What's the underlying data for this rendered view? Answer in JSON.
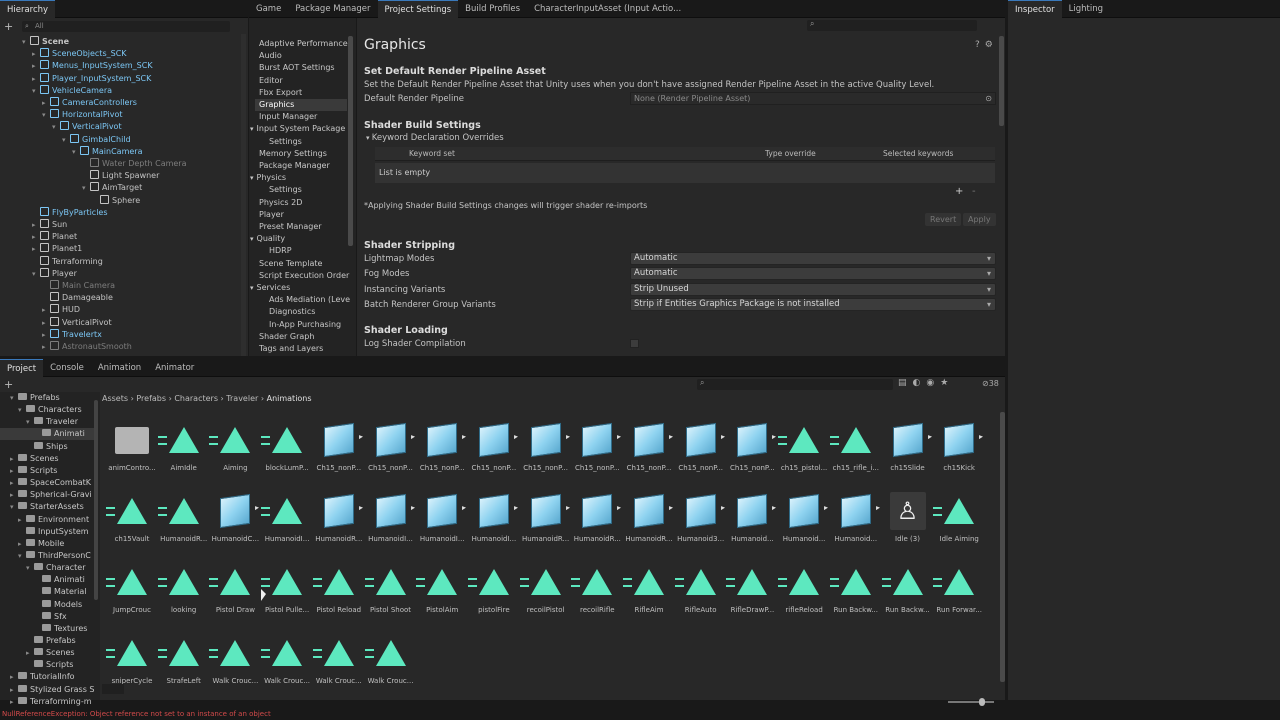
{
  "hierarchy": {
    "tab": "Hierarchy",
    "search_placeholder": "All",
    "items": [
      {
        "label": "Scene",
        "indent": 0,
        "color": "white",
        "arrow": "▾"
      },
      {
        "label": "SceneObjects_SCK",
        "indent": 1,
        "color": "blue",
        "arrow": "▸"
      },
      {
        "label": "Menus_InputSystem_SCK",
        "indent": 1,
        "color": "blue",
        "arrow": "▸"
      },
      {
        "label": "Player_InputSystem_SCK",
        "indent": 1,
        "color": "blue",
        "arrow": "▸"
      },
      {
        "label": "VehicleCamera",
        "indent": 1,
        "color": "blue",
        "arrow": "▾"
      },
      {
        "label": "CameraControllers",
        "indent": 2,
        "color": "blue",
        "arrow": "▸"
      },
      {
        "label": "HorizontalPivot",
        "indent": 2,
        "color": "blue",
        "arrow": "▾"
      },
      {
        "label": "VerticalPivot",
        "indent": 3,
        "color": "blue",
        "arrow": "▾"
      },
      {
        "label": "GimbalChild",
        "indent": 4,
        "color": "blue",
        "arrow": "▾"
      },
      {
        "label": "MainCamera",
        "indent": 5,
        "color": "blue",
        "arrow": "▾"
      },
      {
        "label": "Water Depth Camera",
        "indent": 6,
        "color": "gray",
        "arrow": ""
      },
      {
        "label": "Light Spawner",
        "indent": 6,
        "color": "white",
        "arrow": ""
      },
      {
        "label": "AimTarget",
        "indent": 6,
        "color": "white",
        "arrow": "▾"
      },
      {
        "label": "Sphere",
        "indent": 7,
        "color": "white",
        "arrow": ""
      },
      {
        "label": "FlyByParticles",
        "indent": 1,
        "color": "blue",
        "arrow": ""
      },
      {
        "label": "Sun",
        "indent": 1,
        "color": "white",
        "arrow": "▸"
      },
      {
        "label": "Planet",
        "indent": 1,
        "color": "white",
        "arrow": "▸"
      },
      {
        "label": "Planet1",
        "indent": 1,
        "color": "white",
        "arrow": "▸"
      },
      {
        "label": "Terraforming",
        "indent": 1,
        "color": "white",
        "arrow": ""
      },
      {
        "label": "Player",
        "indent": 1,
        "color": "white",
        "arrow": "▾"
      },
      {
        "label": "Main Camera",
        "indent": 2,
        "color": "gray",
        "arrow": ""
      },
      {
        "label": "Damageable",
        "indent": 2,
        "color": "white",
        "arrow": ""
      },
      {
        "label": "HUD",
        "indent": 2,
        "color": "white",
        "arrow": "▸"
      },
      {
        "label": "VerticalPivot",
        "indent": 2,
        "color": "white",
        "arrow": "▸"
      },
      {
        "label": "Travelertx",
        "indent": 2,
        "color": "blue",
        "arrow": "▸"
      },
      {
        "label": "AstronautSmooth",
        "indent": 2,
        "color": "gray",
        "arrow": "▸"
      }
    ]
  },
  "top_tabs": [
    "Game",
    "Package Manager",
    "Project Settings",
    "Build Profiles",
    "CharacterInputAsset (Input Actio..."
  ],
  "right_tabs": [
    "Inspector",
    "Lighting"
  ],
  "settings_nav": [
    {
      "label": "Adaptive Performance",
      "indent": 0
    },
    {
      "label": "Audio",
      "indent": 0
    },
    {
      "label": "Burst AOT Settings",
      "indent": 0
    },
    {
      "label": "Editor",
      "indent": 0
    },
    {
      "label": "Fbx Export",
      "indent": 0
    },
    {
      "label": "Graphics",
      "indent": 0,
      "active": true
    },
    {
      "label": "Input Manager",
      "indent": 0
    },
    {
      "label": "Input System Package",
      "indent": 0,
      "arrow": "▾"
    },
    {
      "label": "Settings",
      "indent": 1
    },
    {
      "label": "Memory Settings",
      "indent": 0
    },
    {
      "label": "Package Manager",
      "indent": 0
    },
    {
      "label": "Physics",
      "indent": 0,
      "arrow": "▾"
    },
    {
      "label": "Settings",
      "indent": 1
    },
    {
      "label": "Physics 2D",
      "indent": 0
    },
    {
      "label": "Player",
      "indent": 0
    },
    {
      "label": "Preset Manager",
      "indent": 0
    },
    {
      "label": "Quality",
      "indent": 0,
      "arrow": "▾"
    },
    {
      "label": "HDRP",
      "indent": 1
    },
    {
      "label": "Scene Template",
      "indent": 0
    },
    {
      "label": "Script Execution Order",
      "indent": 0
    },
    {
      "label": "Services",
      "indent": 0,
      "arrow": "▾"
    },
    {
      "label": "Ads Mediation (Leve",
      "indent": 1
    },
    {
      "label": "Diagnostics",
      "indent": 1
    },
    {
      "label": "In-App Purchasing",
      "indent": 1
    },
    {
      "label": "Shader Graph",
      "indent": 0
    },
    {
      "label": "Tags and Layers",
      "indent": 0
    }
  ],
  "graphics": {
    "title": "Graphics",
    "rp_heading": "Set Default Render Pipeline Asset",
    "rp_desc": "Set the Default Render Pipeline Asset that Unity uses when you don't have assigned Render Pipeline Asset in the active Quality Level.",
    "rp_label": "Default Render Pipeline",
    "rp_value": "None (Render Pipeline Asset)",
    "build_heading": "Shader Build Settings",
    "keyword_foldout": "Keyword Declaration Overrides",
    "col_keyword": "Keyword set",
    "col_type": "Type override",
    "col_selected": "Selected keywords",
    "list_empty": "List is empty",
    "apply_note": "*Applying Shader Build Settings changes will trigger shader re-imports",
    "revert": "Revert",
    "apply": "Apply",
    "stripping_heading": "Shader Stripping",
    "strip_rows": [
      {
        "label": "Lightmap Modes",
        "value": "Automatic"
      },
      {
        "label": "Fog Modes",
        "value": "Automatic"
      },
      {
        "label": "Instancing Variants",
        "value": "Strip Unused"
      },
      {
        "label": "Batch Renderer Group Variants",
        "value": "Strip if Entities Graphics Package is not installed"
      }
    ],
    "loading_heading": "Shader Loading",
    "log_label": "Log Shader Compilation"
  },
  "bottom_tabs": [
    "Project",
    "Console",
    "Animation",
    "Animator"
  ],
  "project_tree": [
    {
      "label": "Prefabs",
      "indent": 1,
      "arrow": "▾"
    },
    {
      "label": "Characters",
      "indent": 2,
      "arrow": "▾"
    },
    {
      "label": "Traveler",
      "indent": 3,
      "arrow": "▾"
    },
    {
      "label": "Animati",
      "indent": 4,
      "arrow": "",
      "selected": true
    },
    {
      "label": "Ships",
      "indent": 3,
      "arrow": ""
    },
    {
      "label": "Scenes",
      "indent": 1,
      "arrow": "▸"
    },
    {
      "label": "Scripts",
      "indent": 1,
      "arrow": "▸"
    },
    {
      "label": "SpaceCombatK",
      "indent": 1,
      "arrow": "▸"
    },
    {
      "label": "Spherical-Gravi",
      "indent": 1,
      "arrow": "▸"
    },
    {
      "label": "StarterAssets",
      "indent": 1,
      "arrow": "▾"
    },
    {
      "label": "Environment",
      "indent": 2,
      "arrow": "▸"
    },
    {
      "label": "InputSystem",
      "indent": 2,
      "arrow": ""
    },
    {
      "label": "Mobile",
      "indent": 2,
      "arrow": "▸"
    },
    {
      "label": "ThirdPersonC",
      "indent": 2,
      "arrow": "▾"
    },
    {
      "label": "Character",
      "indent": 3,
      "arrow": "▾"
    },
    {
      "label": "Animati",
      "indent": 4,
      "arrow": ""
    },
    {
      "label": "Material",
      "indent": 4,
      "arrow": ""
    },
    {
      "label": "Models",
      "indent": 4,
      "arrow": ""
    },
    {
      "label": "Sfx",
      "indent": 4,
      "arrow": ""
    },
    {
      "label": "Textures",
      "indent": 4,
      "arrow": ""
    },
    {
      "label": "Prefabs",
      "indent": 3,
      "arrow": ""
    },
    {
      "label": "Scenes",
      "indent": 3,
      "arrow": "▸"
    },
    {
      "label": "Scripts",
      "indent": 3,
      "arrow": ""
    },
    {
      "label": "TutorialInfo",
      "indent": 1,
      "arrow": "▸"
    },
    {
      "label": "Stylized Grass S",
      "indent": 1,
      "arrow": "▸"
    },
    {
      "label": "Terraforming-m",
      "indent": 1,
      "arrow": "▸"
    }
  ],
  "breadcrumb": [
    "Assets",
    "Prefabs",
    "Characters",
    "Traveler",
    "Animations"
  ],
  "item_count": "38",
  "assets": [
    {
      "name": "animContro...",
      "type": "folder"
    },
    {
      "name": "AimIdle",
      "type": "clip"
    },
    {
      "name": "Aiming",
      "type": "clip"
    },
    {
      "name": "blockLumP...",
      "type": "clip"
    },
    {
      "name": "Ch15_nonP...",
      "type": "model"
    },
    {
      "name": "Ch15_nonP...",
      "type": "model"
    },
    {
      "name": "Ch15_nonP...",
      "type": "model"
    },
    {
      "name": "Ch15_nonP...",
      "type": "model"
    },
    {
      "name": "Ch15_nonP...",
      "type": "model"
    },
    {
      "name": "Ch15_nonP...",
      "type": "model"
    },
    {
      "name": "Ch15_nonP...",
      "type": "model"
    },
    {
      "name": "Ch15_nonP...",
      "type": "model"
    },
    {
      "name": "Ch15_nonP...",
      "type": "model"
    },
    {
      "name": "ch15_pistol...",
      "type": "clip"
    },
    {
      "name": "ch15_rifle_i...",
      "type": "clip"
    },
    {
      "name": "ch15Slide",
      "type": "model"
    },
    {
      "name": "ch15Kick",
      "type": "model"
    },
    {
      "name": "ch15Vault",
      "type": "clip"
    },
    {
      "name": "HumanoidR...",
      "type": "clip"
    },
    {
      "name": "HumanoidC...",
      "type": "model"
    },
    {
      "name": "HumanoidI...",
      "type": "clip"
    },
    {
      "name": "HumanoidR...",
      "type": "model"
    },
    {
      "name": "HumanoidI...",
      "type": "model"
    },
    {
      "name": "HumanoidI...",
      "type": "model"
    },
    {
      "name": "HumanoidI...",
      "type": "model"
    },
    {
      "name": "HumanoidR...",
      "type": "model"
    },
    {
      "name": "HumanoidR...",
      "type": "model"
    },
    {
      "name": "HumanoidR...",
      "type": "model"
    },
    {
      "name": "Humanoid3...",
      "type": "model"
    },
    {
      "name": "Humanoid...",
      "type": "model"
    },
    {
      "name": "Humanoid...",
      "type": "model"
    },
    {
      "name": "Humanoid...",
      "type": "model"
    },
    {
      "name": "Idle (3)",
      "type": "avatar"
    },
    {
      "name": "Idle Aiming",
      "type": "clip"
    },
    {
      "name": "JumpCrouc",
      "type": "clip"
    },
    {
      "name": "looking",
      "type": "clip"
    },
    {
      "name": "Pistol Draw",
      "type": "clip"
    },
    {
      "name": "Pistol Pulle...",
      "type": "clip"
    },
    {
      "name": "Pistol Reload",
      "type": "clip"
    },
    {
      "name": "Pistol Shoot",
      "type": "clip"
    },
    {
      "name": "PistolAim",
      "type": "clip"
    },
    {
      "name": "pistolFire",
      "type": "clip"
    },
    {
      "name": "recoilPistol",
      "type": "clip"
    },
    {
      "name": "recoilRifle",
      "type": "clip"
    },
    {
      "name": "RifleAim",
      "type": "clip"
    },
    {
      "name": "RifleAuto",
      "type": "clip"
    },
    {
      "name": "RifleDrawP...",
      "type": "clip"
    },
    {
      "name": "rifleReload",
      "type": "clip"
    },
    {
      "name": "Run Backw...",
      "type": "clip"
    },
    {
      "name": "Run Backw...",
      "type": "clip"
    },
    {
      "name": "Run Forwar...",
      "type": "clip"
    },
    {
      "name": "sniperCycle",
      "type": "clip"
    },
    {
      "name": "StrafeLeft",
      "type": "clip"
    },
    {
      "name": "Walk Crouc...",
      "type": "clip"
    },
    {
      "name": "Walk Crouc...",
      "type": "clip"
    },
    {
      "name": "Walk Crouc...",
      "type": "clip"
    },
    {
      "name": "Walk Crouc...",
      "type": "clip"
    }
  ],
  "status": "NullReferenceException: Object reference not set to an instance of an object",
  "colors": {
    "accent": "#3a79bb",
    "clip": "#5de8bf",
    "model": "#8fd3f0",
    "error": "#d24a4a"
  }
}
